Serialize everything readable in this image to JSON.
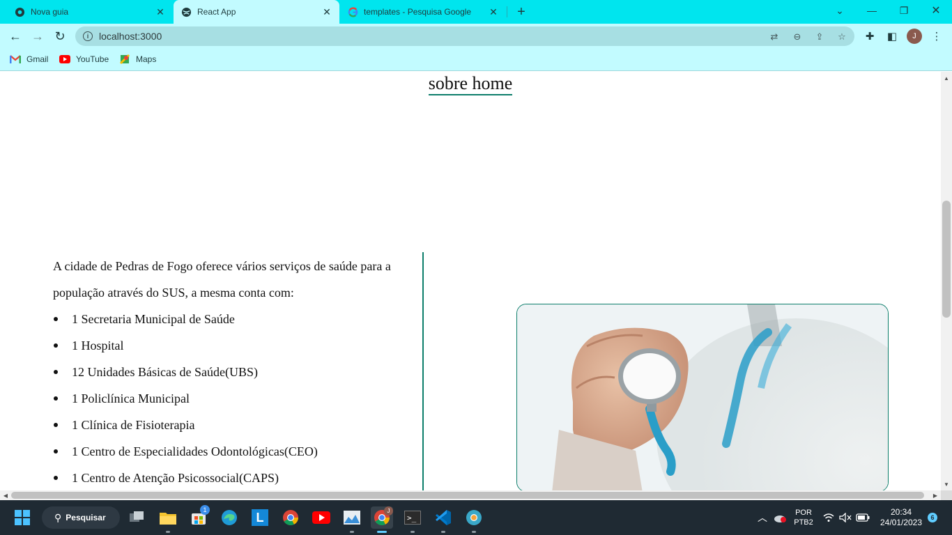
{
  "browser": {
    "tabs": [
      {
        "title": "Nova guia",
        "active": false,
        "favicon": "chrome-icon"
      },
      {
        "title": "React App",
        "active": true,
        "favicon": "globe-icon"
      },
      {
        "title": "templates - Pesquisa Google",
        "active": false,
        "favicon": "google-icon"
      }
    ],
    "url": "localhost:3000",
    "profile_initial": "J",
    "bookmarks": [
      {
        "label": "Gmail",
        "icon": "gmail-icon"
      },
      {
        "label": "YouTube",
        "icon": "youtube-icon"
      },
      {
        "label": "Maps",
        "icon": "maps-icon"
      }
    ],
    "accent": "#00e5ee",
    "toolbar_color": "#c2fbff"
  },
  "page": {
    "title": "sobre home",
    "intro": "A cidade de Pedras de Fogo oferece vários serviços de saúde para a população através do SUS, a mesma conta com:",
    "services": [
      "1 Secretaria Municipal de Saúde",
      "1 Hospital",
      "12 Unidades Básicas de Saúde(UBS)",
      "1 Policlínica Municipal",
      "1 Clínica de Fisioterapia",
      "1 Centro de Especialidades Odontológicas(CEO)",
      "1 Centro de Atenção Psicossocial(CAPS)"
    ],
    "image": "doctor-with-stethoscope-photo",
    "accent": "#0b7d6a"
  },
  "taskbar": {
    "search_label": "Pesquisar",
    "store_badge": "1",
    "language": "POR",
    "layout": "PTB2",
    "time": "20:34",
    "date": "24/01/2023",
    "notification_count": "6",
    "chrome_badge": "J"
  }
}
